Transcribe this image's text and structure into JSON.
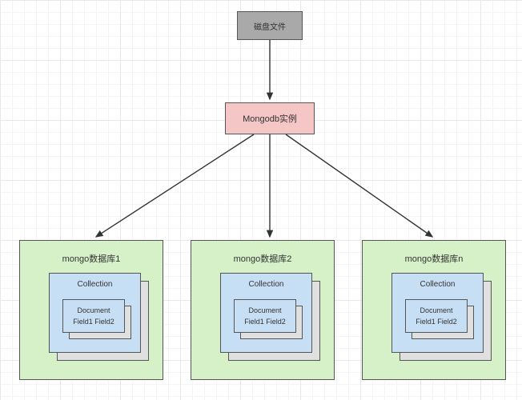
{
  "nodes": {
    "disk": "磁盘文件",
    "instance": "Mongodb实例"
  },
  "databases": [
    {
      "title": "mongo数据库1",
      "collection": "Collection",
      "document": "Document",
      "fields": "Field1  Field2"
    },
    {
      "title": "mongo数据库2",
      "collection": "Collection",
      "document": "Document",
      "fields": "Field1  Field2"
    },
    {
      "title": "mongo数据库n",
      "collection": "Collection",
      "document": "Document",
      "fields": "Field1  Field2"
    }
  ],
  "colors": {
    "disk": "#a9a9a9",
    "instance": "#f5c6c6",
    "database": "#d6f0c8",
    "collection": "#c7dff5"
  }
}
